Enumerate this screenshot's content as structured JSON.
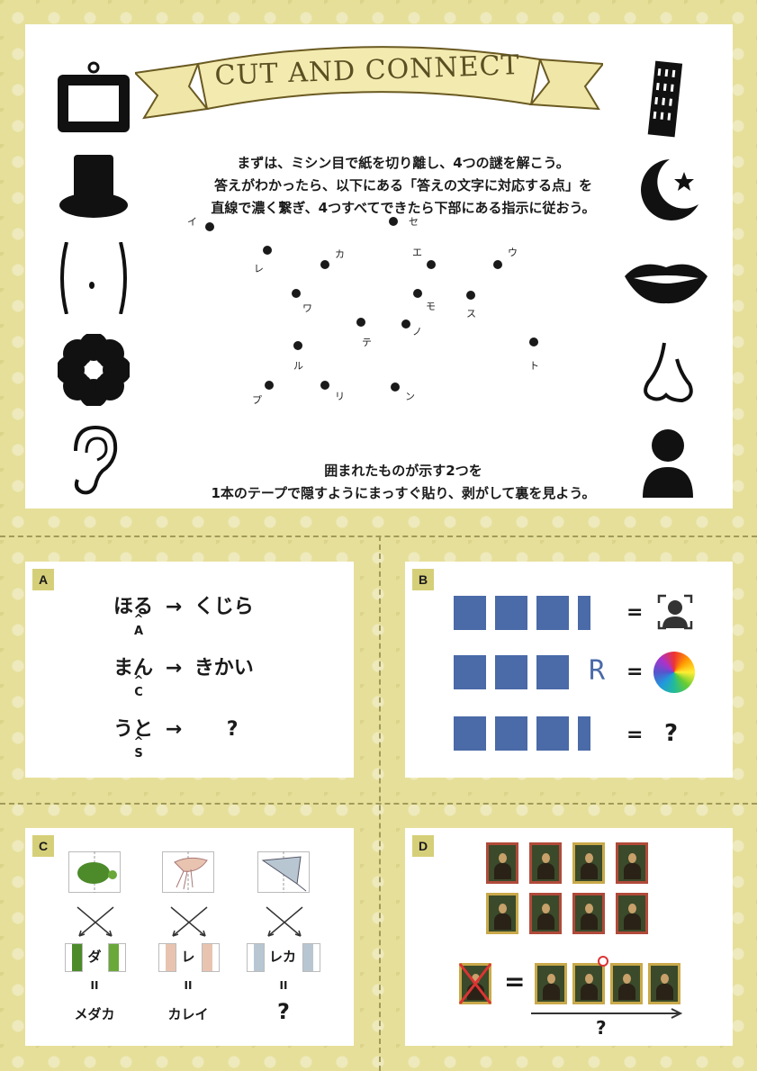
{
  "header": {
    "title": "CUT AND CONNECT",
    "intro_lines": [
      "まずは、ミシン目で紙を切り離し、4つの謎を解こう。",
      "答えがわかったら、以下にある「答えの文字に対応する点」を",
      "直線で濃く繋ぎ、4つすべてできたら下部にある指示に従おう。"
    ],
    "outro_lines": [
      "囲まれたものが示す2つを",
      "1本のテープで隠すようにまっすぐ貼り、剥がして裏を見よう。"
    ]
  },
  "left_icons": [
    "picture-frame-icon",
    "top-hat-icon",
    "waist-icon",
    "flower-icon",
    "ear-icon"
  ],
  "right_icons": [
    "leaning-tower-icon",
    "crescent-star-icon",
    "lips-icon",
    "nose-icon",
    "person-icon"
  ],
  "dot_labels": [
    "イ",
    "セ",
    "レ",
    "カ",
    "エ",
    "ウ",
    "ワ",
    "モ",
    "ス",
    "テ",
    "ノ",
    "ト",
    "ル",
    "プ",
    "リ",
    "ン"
  ],
  "puzzle_a": {
    "tag": "A",
    "rows": [
      {
        "left": "ほる",
        "arrow": "→",
        "right": "くじら",
        "caret": "^",
        "letter": "A"
      },
      {
        "left": "まん",
        "arrow": "→",
        "right": "きかい",
        "caret": "^",
        "letter": "C"
      },
      {
        "left": "うと",
        "arrow": "→",
        "right": "?",
        "caret": "^",
        "letter": "S"
      }
    ]
  },
  "puzzle_b": {
    "tag": "B",
    "extra_letter": "R",
    "equals": "=",
    "question": "?",
    "icons": [
      "face-scan-icon",
      "color-wheel-icon"
    ]
  },
  "puzzle_c": {
    "tag": "C",
    "middles": [
      "ダ",
      "レ",
      "レカ"
    ],
    "equals": "II",
    "answers": [
      "メダカ",
      "カレイ",
      "?"
    ],
    "icons": [
      "turtle-icon",
      "squid-icon",
      "stingray-icon"
    ]
  },
  "puzzle_d": {
    "tag": "D",
    "equals": "=",
    "question": "?"
  },
  "colors": {
    "background": "#e6df9a",
    "tag": "#d6cf7a",
    "segment": "#4a6aa8",
    "frame_red": "#b04a3a",
    "frame_gold": "#c9a94a"
  }
}
